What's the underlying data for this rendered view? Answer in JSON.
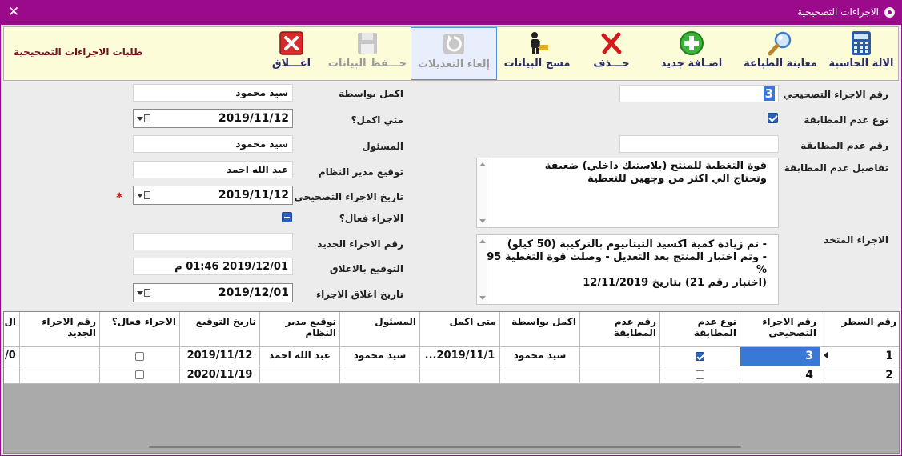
{
  "window": {
    "title": "الاجراءات التصحيحية",
    "accent_color": "#9b0a8a"
  },
  "toolbar": {
    "title": "طلبات الاجراءات التصحيحية",
    "buttons": [
      {
        "label": "الالة الحاسبة",
        "icon": "calculator-icon"
      },
      {
        "label": "معاينة الطباعة",
        "icon": "magnifier-icon"
      },
      {
        "label": "اضـافة جديد",
        "icon": "add-icon"
      },
      {
        "label": "حـــذف",
        "icon": "delete-icon"
      },
      {
        "label": "مسح البيانات",
        "icon": "clear-data-icon"
      },
      {
        "label": "إلغاء التعديلات",
        "icon": "undo-icon"
      },
      {
        "label": "حـــفظ البيانات",
        "icon": "save-icon"
      },
      {
        "label": "اغـــلاق",
        "icon": "close-icon"
      }
    ]
  },
  "form": {
    "corrective_no": {
      "label": "رقم الاجراء التصحيحي",
      "value": "3"
    },
    "nonconformity_type": {
      "label": "نوع عدم المطابقة",
      "checked": true
    },
    "nonconformity_no": {
      "label": "رقم عدم المطابقة",
      "value": ""
    },
    "nonconformity_details": {
      "label": "تفاصيل عدم المطابقة",
      "lines": [
        "قوة التغطية للمنتج (بلاستيك داخلي) ضعيفة",
        "وتحتاج الي اكثر من وجهين للتغطية"
      ]
    },
    "action_taken": {
      "label": "الاجراء المتخذ",
      "lines": [
        "- تم زيادة كمية اكسيد التيتانيوم بالتركيبة (50 كيلو)",
        "- وتم اختبار المنتج بعد التعديل - وصلت قوة التغطية 95 %",
        "(اختبار رقم 21) بتاريخ 12/11/2019"
      ]
    },
    "completed_by": {
      "label": "اكمل بواسطة",
      "value": "سيد محمود"
    },
    "completed_when": {
      "label": "متي اكمل؟",
      "value": "2019/11/12"
    },
    "responsible": {
      "label": "المسئول",
      "value": "سيد محمود"
    },
    "system_manager_sign": {
      "label": "توقيع مدير النظام",
      "value": "عبد الله احمد"
    },
    "corrective_date": {
      "label": "تاريخ الاجراء التصحيحي",
      "value": "2019/11/12",
      "required_mark": "*"
    },
    "effective": {
      "label": "الاجراء فعال؟",
      "state": "indeterminate"
    },
    "new_action_no": {
      "label": "رقم الاجراء الجديد",
      "value": ""
    },
    "closing_sign": {
      "label": "التوقيع بالاغلاق",
      "value": "2019/12/01 01:46 م"
    },
    "closing_date": {
      "label": "تاريخ اغلاق الاجراء",
      "value": "2019/12/01"
    }
  },
  "grid": {
    "columns": [
      "رقم السطر",
      "رقم الاجراء التصحيحي",
      "نوع عدم المطابقة",
      "رقم عدم المطابقة",
      "اكمل بواسطة",
      "متى اكمل",
      "المسئول",
      "توقيع مدير النظام",
      "تاريخ التوقيع",
      "الاجراء فعال؟",
      "رقم الاجراء الجديد",
      "ال"
    ],
    "rows": [
      {
        "line": "1",
        "corrective_no": "3",
        "type_checked": true,
        "nc_no": "",
        "completed_by": "سيد محمود",
        "completed_when": "2019/11/1...",
        "responsible": "سيد محمود",
        "manager_sign": "عبد الله احمد",
        "sign_date": "2019/11/12",
        "effective_checked": false,
        "new_no": "",
        "extra": "0/"
      },
      {
        "line": "2",
        "corrective_no": "4",
        "type_checked": false,
        "nc_no": "",
        "completed_by": "",
        "completed_when": "",
        "responsible": "",
        "manager_sign": "",
        "sign_date": "2020/11/19",
        "effective_checked": false,
        "new_no": "",
        "extra": ""
      }
    ]
  }
}
